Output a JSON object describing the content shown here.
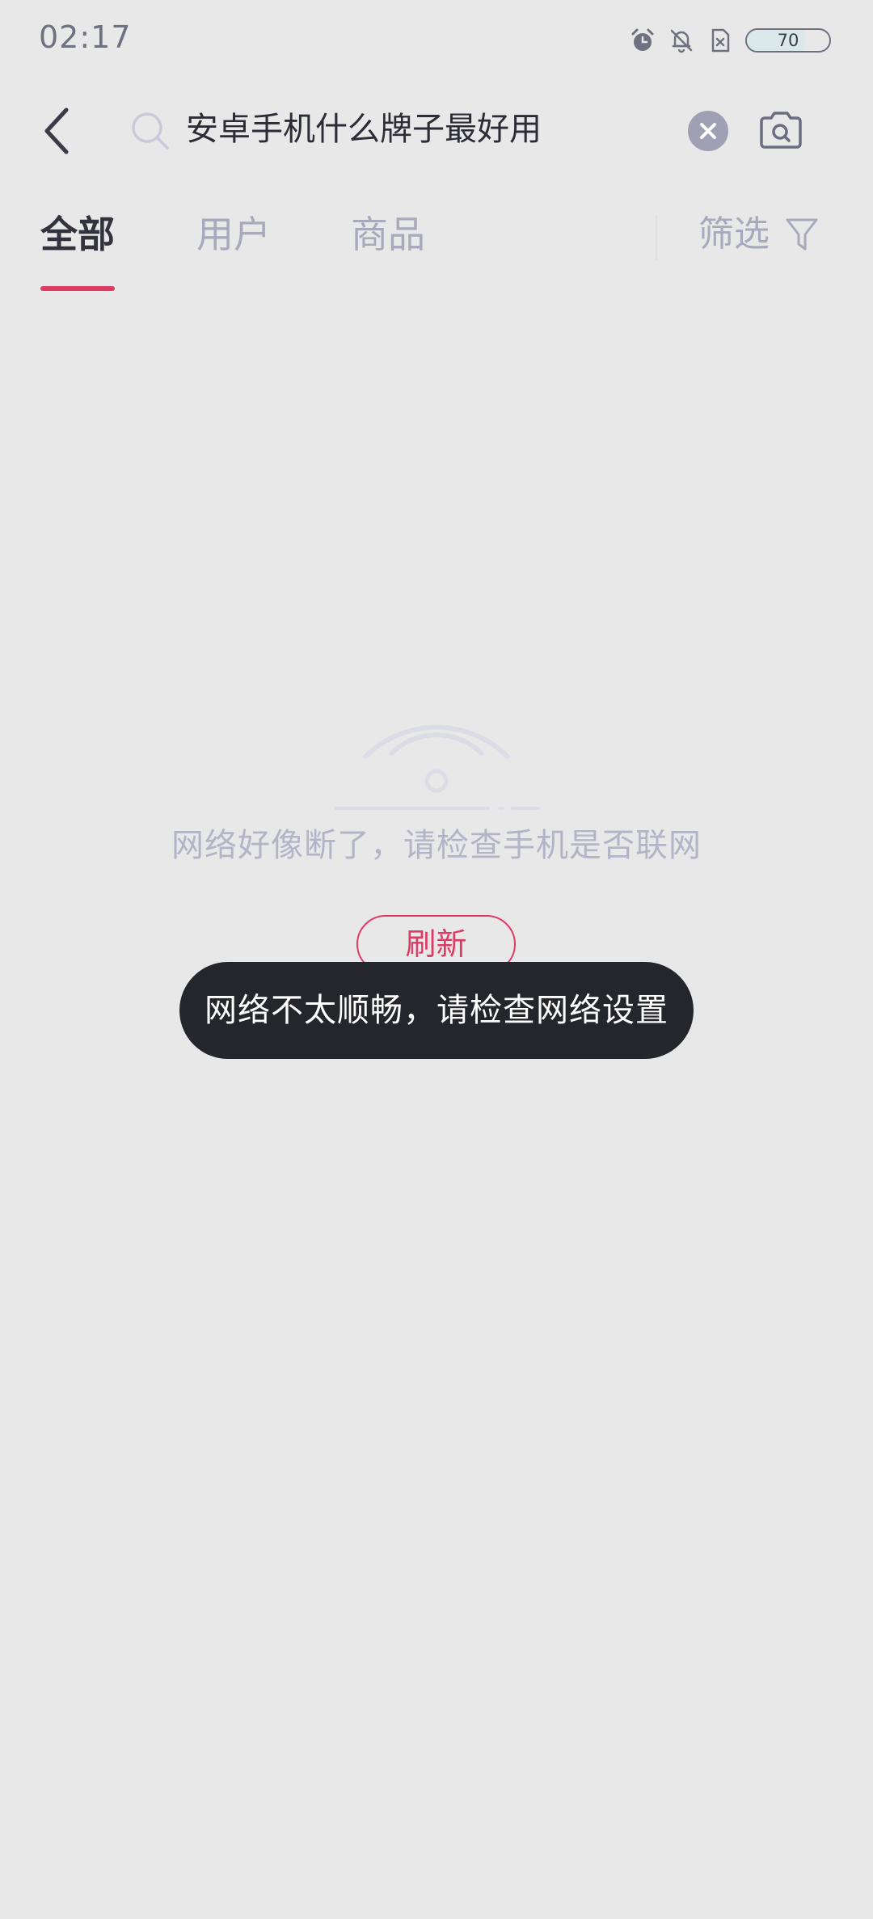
{
  "status_bar": {
    "time": "02:17",
    "icons": [
      "alarm-icon",
      "notifications-off-icon",
      "sim-off-icon"
    ],
    "battery_level": "70",
    "battery_fraction": 0.7
  },
  "search": {
    "query": "安卓手机什么牌子最好用",
    "icons": [
      "back-arrow-icon",
      "search-icon",
      "clear-icon",
      "camera-icon"
    ]
  },
  "tabs": {
    "items": [
      {
        "label": "全部",
        "active": true
      },
      {
        "label": "用户",
        "active": false
      },
      {
        "label": "商品",
        "active": false
      }
    ],
    "filter_label": "筛选"
  },
  "empty_state": {
    "icon": "wifi-disconnected-icon",
    "message": "网络好像断了，请检查手机是否联网",
    "refresh_label": "刷新"
  },
  "toast": {
    "message": "网络不太顺畅，请检查网络设置"
  },
  "colors": {
    "background": "#e8e8e9",
    "accent": "#dd3a64",
    "text_primary": "#33333e",
    "text_muted": "#a8a9bd",
    "toast_background": "#25262b"
  }
}
